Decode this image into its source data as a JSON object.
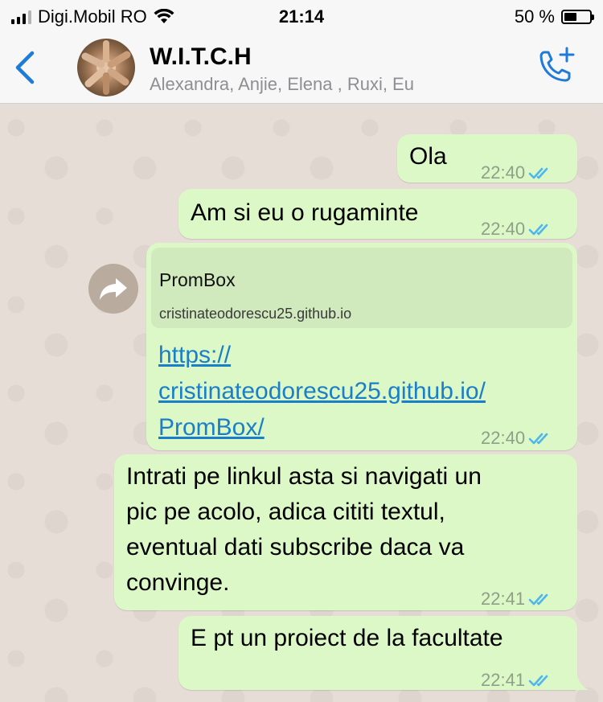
{
  "status_bar": {
    "carrier": "Digi.Mobil RO",
    "time": "21:14",
    "battery_text": "50 %",
    "battery_level": 0.5
  },
  "header": {
    "back_icon": "chevron-left-icon",
    "title": "W.I.T.C.H",
    "participants": "Alexandra, Anjie, Elena , Ruxi, Eu",
    "call_icon": "add-call-icon"
  },
  "messages": [
    {
      "text": "Ola",
      "time": "22:40",
      "status": "read"
    },
    {
      "text": "Am si eu o rugaminte",
      "time": "22:40",
      "status": "read"
    },
    {
      "preview_title": "PromBox",
      "preview_domain": "cristinateodorescu25.github.io",
      "link_lines": [
        "https://",
        "cristinateodorescu25.github.io/",
        "PromBox/"
      ],
      "time": "22:40",
      "status": "read"
    },
    {
      "lines": [
        "Intrati pe linkul asta si navigati un",
        "pic pe acolo, adica cititi textul,",
        "eventual dati subscribe daca va",
        "convinge."
      ],
      "time": "22:41",
      "status": "read"
    },
    {
      "text": "E pt un proiect de la facultate",
      "time": "22:41",
      "status": "read"
    }
  ],
  "colors": {
    "outgoing_bubble": "#dcf8c6",
    "link": "#1b7ec9",
    "ios_blue": "#1f7bd9",
    "read_ticks": "#4fb6ec"
  }
}
